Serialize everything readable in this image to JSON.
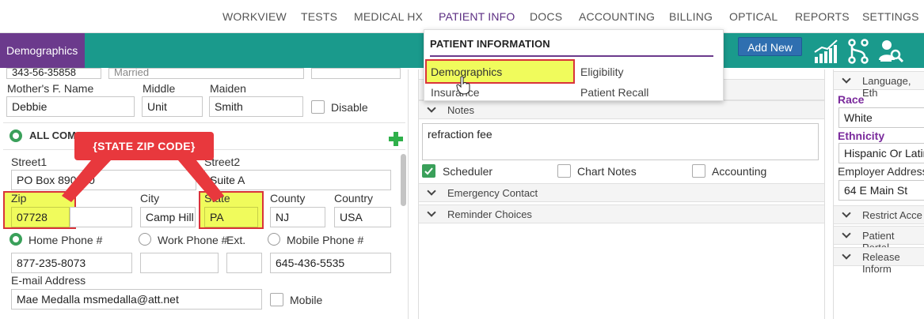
{
  "nav": {
    "items": [
      "WORKVIEW",
      "TESTS",
      "MEDICAL HX",
      "PATIENT INFO",
      "DOCS",
      "ACCOUNTING",
      "BILLING",
      "OPTICAL",
      "REPORTS",
      "SETTINGS"
    ],
    "active_index": 3
  },
  "toolbar": {
    "section_tab": "Demographics",
    "add_new_label": "Add New"
  },
  "dropdown": {
    "heading": "PATIENT INFORMATION",
    "options": [
      "Demographics",
      "Eligibility",
      "Insurance",
      "Patient Recall"
    ]
  },
  "left": {
    "top_row": {
      "ssn": "343-56-35858",
      "marital": "Married"
    },
    "mother_label": "Mother's F. Name",
    "middle_label": "Middle",
    "maiden_label": "Maiden",
    "mother_value": "Debbie",
    "middle_value": "Unit",
    "maiden_value": "Smith",
    "disable_label": "Disable",
    "all_comm_label": "ALL COM",
    "street1_label": "Street1",
    "street2_label": "Street2",
    "street1_value": "PO Box 890050",
    "street2_value": "Suite A",
    "zip_label": "Zip",
    "city_label": "City",
    "state_label": "State",
    "county_label": "County",
    "country_label": "Country",
    "zip_value": "07728",
    "city_value": "Camp Hill",
    "state_value": "PA",
    "county_value": "NJ",
    "country_value": "USA",
    "home_phone_label": "Home Phone #",
    "work_phone_label": "Work Phone #",
    "ext_label": "Ext.",
    "mobile_phone_label": "Mobile Phone #",
    "home_phone_value": "877-235-8073",
    "mobile_phone_value": "645-436-5535",
    "email_label": "E-mail Address",
    "email_value": "Mae Medalla  msmedalla@att.net",
    "mobile_check_label": "Mobile"
  },
  "callout": {
    "text": "{STATE ZIP CODE}"
  },
  "middle": {
    "notes_label": "Notes",
    "notes_value": "refraction fee",
    "scheduler_label": "Scheduler",
    "chart_notes_label": "Chart Notes",
    "accounting_label": "Accounting",
    "emergency_label": "Emergency Contact",
    "reminder_label": "Reminder Choices"
  },
  "right": {
    "lang_label": "Language, Eth",
    "race_label": "Race",
    "race_value": "White",
    "ethnicity_label": "Ethnicity",
    "ethnicity_value": "Hispanic Or Latin",
    "employer_label": "Employer Address",
    "employer_value": "64 E Main St",
    "restrict_label": "Restrict Acce",
    "portal_label": "Patient Portal",
    "release_label": "Release Inform"
  },
  "colors": {
    "teal": "#1a9a8c",
    "purple": "#6b3a8c",
    "highlight": "#f0fb5c",
    "callout_red": "#e8383d",
    "check_green": "#3aa05a"
  }
}
